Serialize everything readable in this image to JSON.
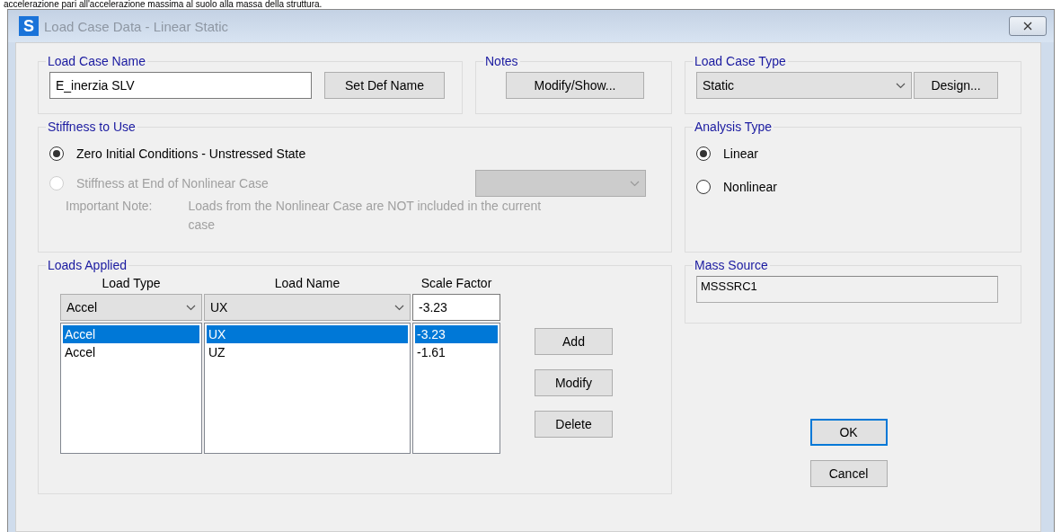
{
  "document_text": "accelerazione pari all'accelerazione massima al suolo alla massa della struttura.",
  "window": {
    "title": "Load Case Data - Linear Static",
    "logo": "S"
  },
  "load_case_name": {
    "label": "Load Case Name",
    "value": "E_inerzia SLV",
    "button": "Set Def Name"
  },
  "notes": {
    "label": "Notes",
    "button": "Modify/Show..."
  },
  "stiffness": {
    "label": "Stiffness to Use",
    "options": [
      {
        "label": "Zero Initial Conditions - Unstressed State",
        "selected": true,
        "disabled": false
      },
      {
        "label": "Stiffness at End of Nonlinear Case",
        "selected": false,
        "disabled": true
      }
    ],
    "nonlinear_case_dropdown": {
      "disabled": true
    },
    "note_label": "Important Note:",
    "note_text": "Loads from the Nonlinear Case are NOT included in the current case"
  },
  "loads_applied": {
    "label": "Loads Applied",
    "columns": [
      "Load Type",
      "Load Name",
      "Scale Factor"
    ],
    "editor": {
      "load_type": "Accel",
      "load_name": "UX",
      "scale_factor": "-3.23"
    },
    "rows": [
      {
        "load_type": "Accel",
        "load_name": "UX",
        "scale_factor": "-3.23",
        "selected": true
      },
      {
        "load_type": "Accel",
        "load_name": "UZ",
        "scale_factor": "-1.61",
        "selected": false
      }
    ],
    "buttons": [
      "Add",
      "Modify",
      "Delete"
    ]
  },
  "load_case_type": {
    "label": "Load Case Type",
    "value": "Static",
    "button": "Design..."
  },
  "analysis_type": {
    "label": "Analysis Type",
    "options": [
      {
        "label": "Linear",
        "selected": true
      },
      {
        "label": "Nonlinear",
        "selected": false
      }
    ]
  },
  "mass_source": {
    "label": "Mass Source",
    "value": "MSSSRC1"
  },
  "dialog_buttons": [
    {
      "label": "OK",
      "default": true
    },
    {
      "label": "Cancel",
      "default": false
    }
  ]
}
